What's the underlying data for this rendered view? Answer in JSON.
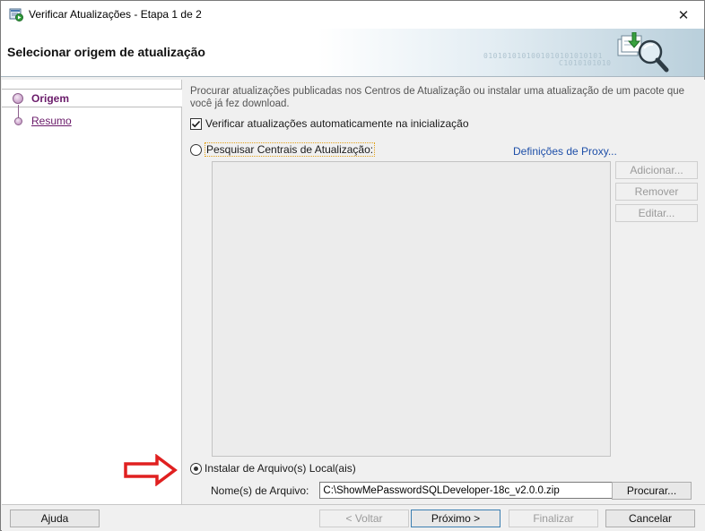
{
  "window": {
    "title": "Verificar Atualizações - Etapa 1 de 2",
    "close_glyph": "✕"
  },
  "header": {
    "title": "Selecionar origem de atualização",
    "binary_line1": "0101010101001010101010101",
    "binary_line2": "C1010101010"
  },
  "steps": [
    {
      "label": "Origem",
      "state": "active"
    },
    {
      "label": "Resumo",
      "state": "link"
    }
  ],
  "main": {
    "description": "Procurar atualizações publicadas nos Centros de Atualização ou instalar uma atualização de um pacote que você já fez download.",
    "auto_check_label": "Verificar atualizações automaticamente na inicialização",
    "auto_check_checked": true,
    "search_centers_label": "Pesquisar Centrais de Atualização:",
    "proxy_link": "Definições de Proxy...",
    "add_button": "Adicionar...",
    "remove_button": "Remover",
    "edit_button": "Editar...",
    "local_install_label": "Instalar de Arquivo(s) Local(ais)",
    "file_name_label": "Nome(s) de Arquivo:",
    "file_name_value": "C:\\ShowMePasswordSQLDeveloper-18c_v2.0.0.zip",
    "browse_button": "Procurar..."
  },
  "footer": {
    "help": "Ajuda",
    "back": "< Voltar",
    "next": "Próximo >",
    "finish": "Finalizar",
    "cancel": "Cancelar"
  },
  "colors": {
    "step_accent": "#6a1b6a",
    "link": "#1e4fa8",
    "annotation_arrow": "#e02020",
    "focus_outline": "#e3a21a"
  }
}
